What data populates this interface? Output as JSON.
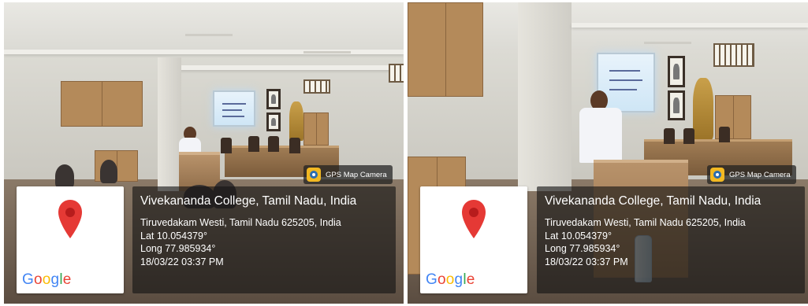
{
  "photos": [
    {
      "badge": {
        "icon": "gps-camera-icon",
        "label": "GPS Map Camera"
      },
      "map": {
        "pin_icon": "map-pin-icon",
        "pin_color": "#e53935",
        "logo": "Google"
      },
      "location": {
        "title": "Vivekananda College, Tamil Nadu, India",
        "address": "Tiruvedakam Westi, Tamil Nadu 625205, India",
        "lat": "Lat 10.054379°",
        "long": "Long 77.985934°",
        "timestamp": "18/03/22 03:37 PM"
      }
    },
    {
      "badge": {
        "icon": "gps-camera-icon",
        "label": "GPS Map Camera"
      },
      "map": {
        "pin_icon": "map-pin-icon",
        "pin_color": "#e53935",
        "logo": "Google"
      },
      "location": {
        "title": "Vivekananda College, Tamil Nadu, India",
        "address": "Tiruvedakam Westi, Tamil Nadu 625205, India",
        "lat": "Lat 10.054379°",
        "long": "Long 77.985934°",
        "timestamp": "18/03/22 03:37 PM"
      }
    }
  ],
  "colors": {
    "google_blue": "#4285f4",
    "google_red": "#ea4335",
    "google_yellow": "#fbbc05",
    "google_green": "#34a853"
  }
}
